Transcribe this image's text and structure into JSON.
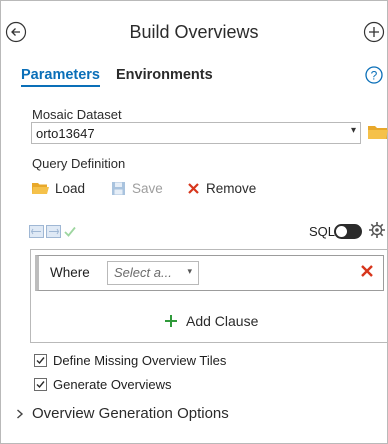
{
  "header": {
    "title": "Build Overviews",
    "back_icon": "back-arrow-circle-icon",
    "add_icon": "add-circle-icon"
  },
  "tabs": [
    {
      "label": "Parameters",
      "active": true
    },
    {
      "label": "Environments",
      "active": false
    }
  ],
  "help_icon": "help-icon",
  "mosaic_dataset": {
    "label": "Mosaic Dataset",
    "value": "orto13647"
  },
  "query_definition": {
    "label": "Query Definition",
    "load_label": "Load",
    "save_label": "Save",
    "remove_label": "Remove",
    "sql_label": "SQL",
    "sql_toggle_on": false,
    "clause": {
      "where_label": "Where",
      "field_placeholder": "Select a..."
    },
    "add_clause_label": "Add Clause"
  },
  "options": [
    {
      "label": "Define Missing Overview Tiles",
      "checked": true
    },
    {
      "label": "Generate Overviews",
      "checked": true
    }
  ],
  "expander": {
    "label": "Overview Generation Options",
    "expanded": false
  },
  "colors": {
    "accent": "#0a6fb8",
    "folder": "#e8a82a",
    "remove": "#d7361c",
    "add": "#2f9a3a"
  }
}
